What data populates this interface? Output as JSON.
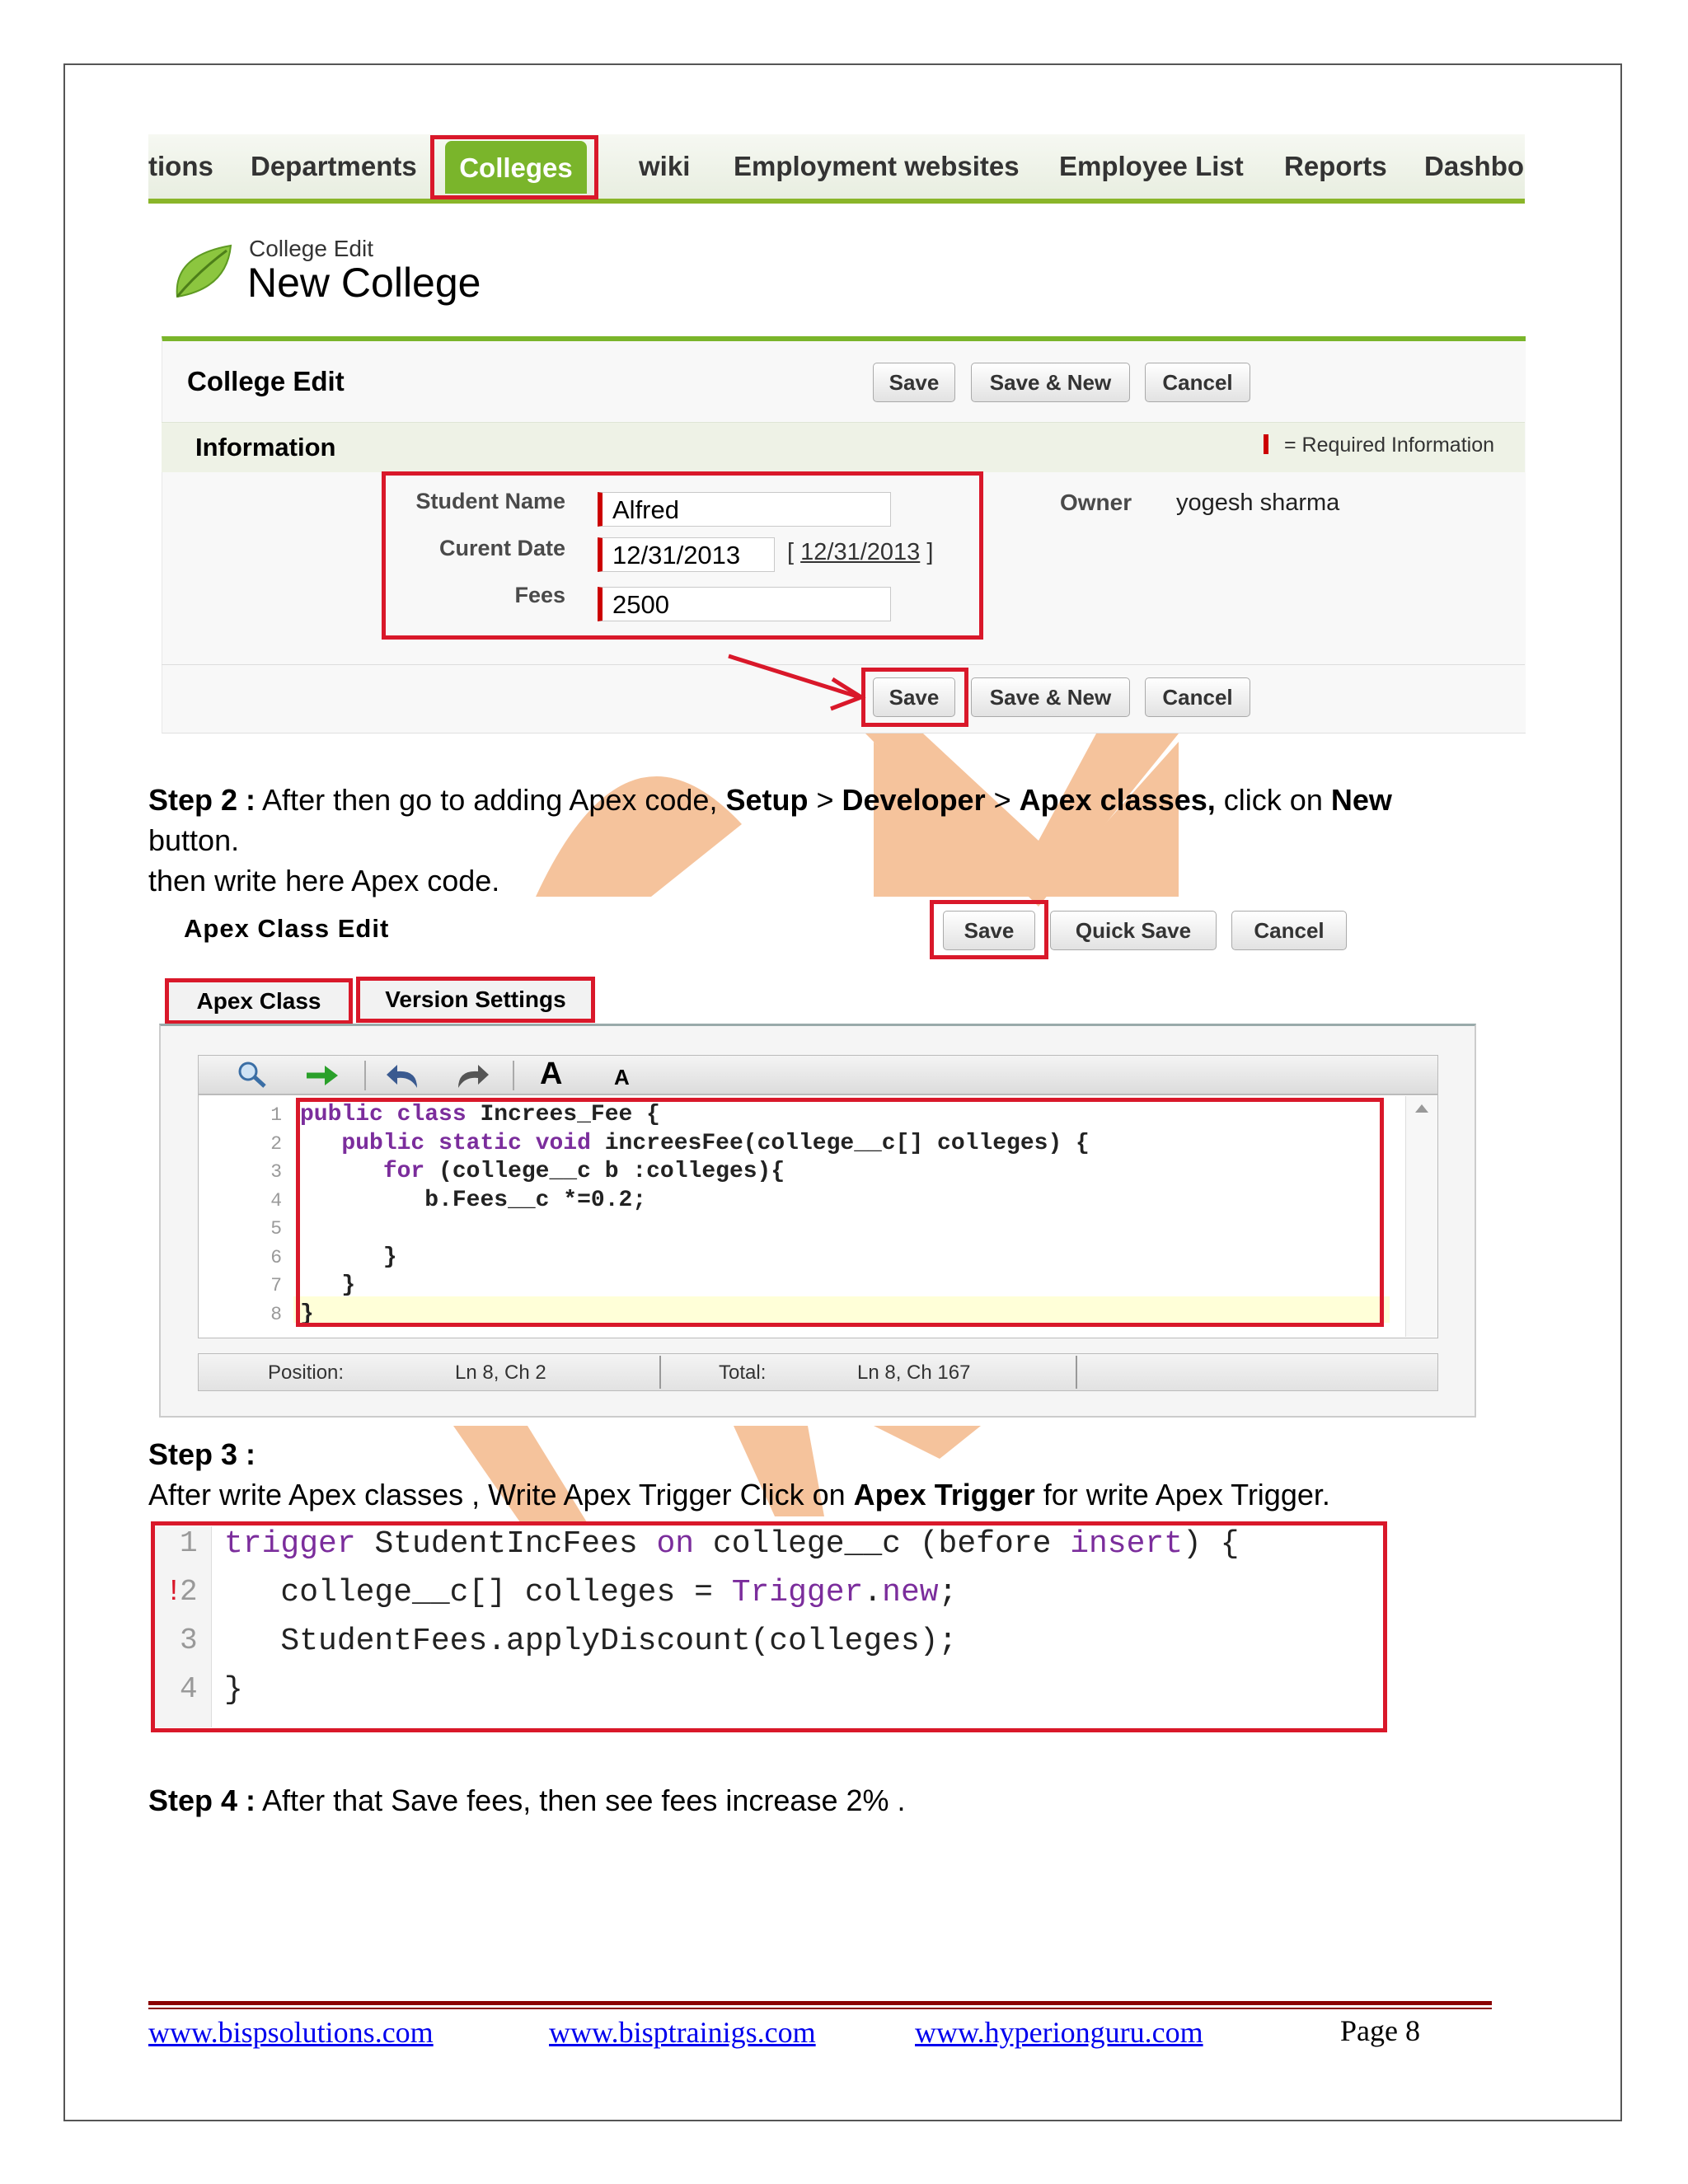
{
  "nav": {
    "items": [
      "tions",
      "Departments",
      "Colleges",
      "wiki",
      "Employment websites",
      "Employee List",
      "Reports",
      "Dashbo"
    ],
    "active": "Colleges"
  },
  "college_edit": {
    "subtitle": "College Edit",
    "title": "New College",
    "section_title": "College Edit",
    "buttons": {
      "save": "Save",
      "save_new": "Save & New",
      "cancel": "Cancel"
    },
    "info_title": "Information",
    "required_text": "= Required Information",
    "fields": {
      "student_name_label": "Student Name",
      "student_name_value": "Alfred",
      "current_date_label": "Curent Date",
      "current_date_value": "12/31/2013",
      "current_date_link": "12/31/2013",
      "fees_label": "Fees",
      "fees_value": "2500",
      "owner_label": "Owner",
      "owner_value": "yogesh sharma"
    }
  },
  "step2": {
    "label": "Step 2 :",
    "t1": " After then go to adding Apex code, ",
    "b1": "Setup",
    "t2": " > ",
    "b2": "Developer",
    "t3": " > ",
    "b3": "Apex classes,",
    "t4": " click on ",
    "b4": "New",
    "line2": "button.",
    "line3": "then write here Apex code."
  },
  "apex_edit": {
    "title": "Apex Class Edit",
    "buttons": {
      "save": "Save",
      "quick_save": "Quick Save",
      "cancel": "Cancel"
    },
    "tabs": [
      "Apex Class",
      "Version Settings"
    ],
    "toolbar": {
      "big_a": "A",
      "small_a": "A"
    },
    "code_lines": [
      {
        "n": "1",
        "text": "public class Increes_Fee {"
      },
      {
        "n": "2",
        "text": "   public static void increesFee(college__c[] colleges) {"
      },
      {
        "n": "3",
        "text": "      for (college__c b :colleges){"
      },
      {
        "n": "4",
        "text": "         b.Fees__c *=0.2;"
      },
      {
        "n": "5",
        "text": ""
      },
      {
        "n": "6",
        "text": "      }"
      },
      {
        "n": "7",
        "text": "   }"
      },
      {
        "n": "8",
        "text": "}"
      }
    ],
    "status": {
      "position_label": "Position:",
      "position_value": "Ln 8, Ch 2",
      "total_label": "Total:",
      "total_value": "Ln 8, Ch 167"
    }
  },
  "step3": {
    "label": "Step 3 :",
    "t1": "After write Apex classes , Write Apex Trigger Click on ",
    "b1": "Apex Trigger",
    "t2": " for write Apex Trigger."
  },
  "trigger_code": {
    "lines": [
      {
        "n": "1",
        "marker": "",
        "parts": [
          {
            "k": true,
            "t": "trigger"
          },
          {
            "k": false,
            "t": " StudentIncFees "
          },
          {
            "k": true,
            "t": "on"
          },
          {
            "k": false,
            "t": " college__c (before "
          },
          {
            "k": true,
            "t": "insert"
          },
          {
            "k": false,
            "t": ") {"
          }
        ]
      },
      {
        "n": "2",
        "marker": "!",
        "parts": [
          {
            "k": false,
            "t": "   college__c[] colleges = "
          },
          {
            "k": true,
            "t": "Trigger"
          },
          {
            "k": false,
            "t": "."
          },
          {
            "k": true,
            "t": "new"
          },
          {
            "k": false,
            "t": ";"
          }
        ]
      },
      {
        "n": "3",
        "marker": "",
        "parts": [
          {
            "k": false,
            "t": "   StudentFees.applyDiscount(colleges);"
          }
        ]
      },
      {
        "n": "4",
        "marker": "",
        "parts": [
          {
            "k": false,
            "t": "}"
          }
        ]
      }
    ]
  },
  "step4": {
    "label": "Step 4 :",
    "text": " After that Save fees, then see fees increase 2% ."
  },
  "footer": {
    "links": [
      "www.bispsolutions.com",
      "www.bisptrainigs.com",
      "www.hyperionguru.com"
    ],
    "page": "Page 8"
  },
  "colors": {
    "accent_green": "#7ab52b",
    "annotation_red": "#d9182a",
    "watermark_orange": "#f0a060",
    "keyword_purple": "#7b2d9c"
  }
}
